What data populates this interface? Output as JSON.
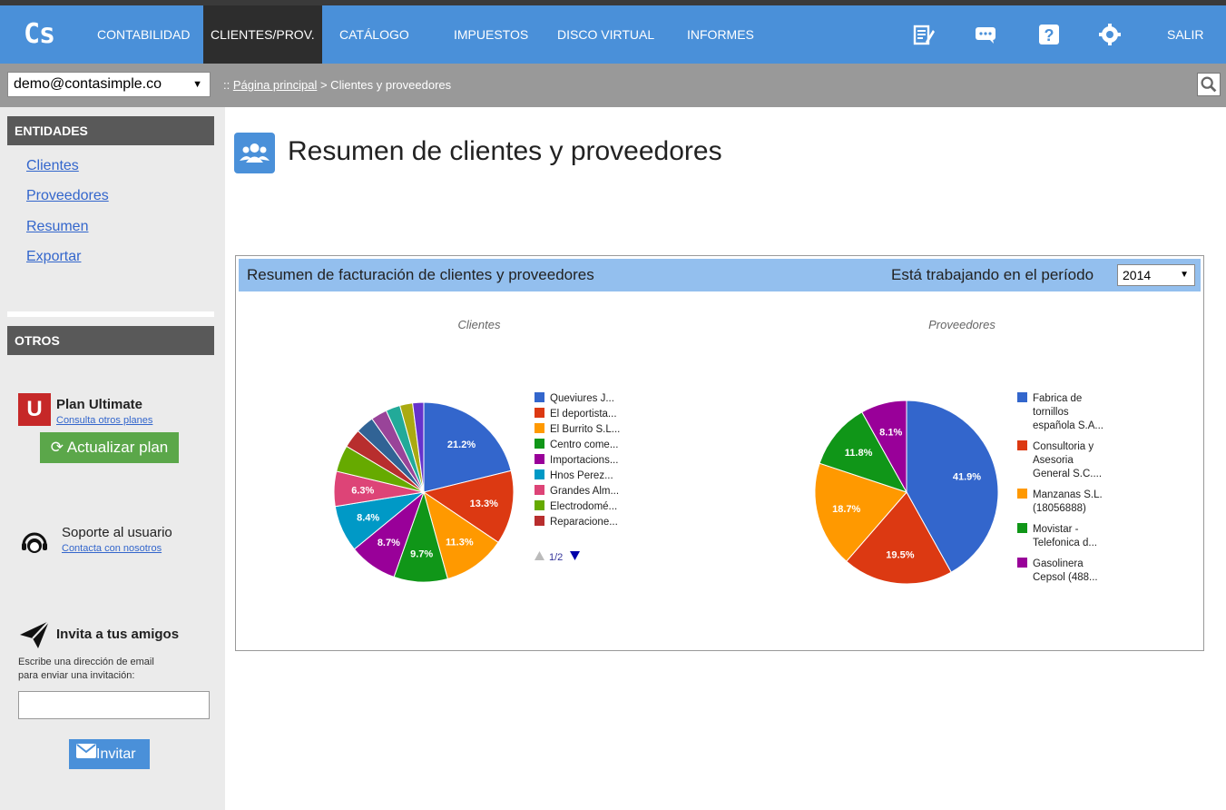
{
  "app": {
    "logo_text": "Cs"
  },
  "nav": {
    "items": [
      {
        "label": "CONTABILIDAD",
        "active": false
      },
      {
        "label": "CLIENTES/PROV.",
        "active": true
      },
      {
        "label": "CATÁLOGO",
        "active": false
      },
      {
        "label": "IMPUESTOS",
        "active": false
      },
      {
        "label": "DISCO VIRTUAL",
        "active": false
      },
      {
        "label": "INFORMES",
        "active": false
      }
    ],
    "icons": [
      "notes-icon",
      "chat-icon",
      "help-icon",
      "settings-icon"
    ],
    "logout_label": "SALIR"
  },
  "subbar": {
    "user": "demo@contasimple.co",
    "breadcrumb_prefix": ":: ",
    "breadcrumb_home": "Página principal",
    "breadcrumb_current": " > Clientes y proveedores"
  },
  "sidebar": {
    "entities_title": "ENTIDADES",
    "entities": [
      "Clientes",
      "Proveedores",
      "Resumen",
      "Exportar"
    ],
    "others_title": "OTROS",
    "plan_badge": "U",
    "plan_name": "Plan Ultimate",
    "plan_link": "Consulta otros planes",
    "upgrade_label": "Actualizar plan",
    "support_title": "Soporte al usuario",
    "support_link": "Contacta con nosotros",
    "invite_title": "Invita a tus amigos",
    "invite_text_1": "Escribe una dirección de email",
    "invite_text_2": "para enviar una invitación:",
    "invite_placeholder": "",
    "invite_button": "Invitar"
  },
  "main": {
    "title": "Resumen de clientes y proveedores",
    "panel_title": "Resumen de facturación de clientes y proveedores",
    "period_label": "Está trabajando en el período",
    "period_value": "2014"
  },
  "chart_data": [
    {
      "type": "pie",
      "title": "Clientes",
      "legend_page": "1/2",
      "categories": [
        "Queviures J...",
        "El deportista...",
        "El Burrito S.L...",
        "Centro come...",
        "Importacions...",
        "Hnos Perez...",
        "Grandes Alm...",
        "Electrodomé...",
        "Reparacione...",
        "",
        "",
        "",
        "",
        ""
      ],
      "values": [
        21.2,
        13.3,
        11.3,
        9.7,
        8.7,
        8.4,
        6.3,
        4.8,
        3.4,
        3.3,
        2.9,
        2.6,
        2.3,
        2.0
      ],
      "value_labels": [
        "21.2%",
        "13.3%",
        "11.3%",
        "9.7%",
        "8.7%",
        "8.4%",
        "6.3%",
        "",
        "",
        "",
        "",
        "",
        "",
        ""
      ],
      "colors": [
        "#3366cc",
        "#dc3912",
        "#ff9900",
        "#109618",
        "#990099",
        "#0099c6",
        "#dd4477",
        "#66aa00",
        "#b82e2e",
        "#316395",
        "#994499",
        "#22aa99",
        "#aaaa11",
        "#6633cc"
      ]
    },
    {
      "type": "pie",
      "title": "Proveedores",
      "categories": [
        "Fabrica de tornillos española S.A...",
        "Consultoria y Asesoria General S.C....",
        "Manzanas S.L. (18056888)",
        "Movistar - Telefonica d...",
        "Gasolinera Cepsol (488..."
      ],
      "legend_lines": [
        [
          "Fabrica de",
          "tornillos",
          "española S.A..."
        ],
        [
          "Consultoria y",
          "Asesoria",
          "General S.C...."
        ],
        [
          "Manzanas S.L.",
          "(18056888)"
        ],
        [
          "Movistar -",
          "Telefonica d..."
        ],
        [
          "Gasolinera",
          "Cepsol (488..."
        ]
      ],
      "values": [
        41.9,
        19.5,
        18.7,
        11.8,
        8.1
      ],
      "value_labels": [
        "41.9%",
        "19.5%",
        "18.7%",
        "11.8%",
        "8.1%"
      ],
      "colors": [
        "#3366cc",
        "#dc3912",
        "#ff9900",
        "#109618",
        "#990099"
      ]
    }
  ]
}
